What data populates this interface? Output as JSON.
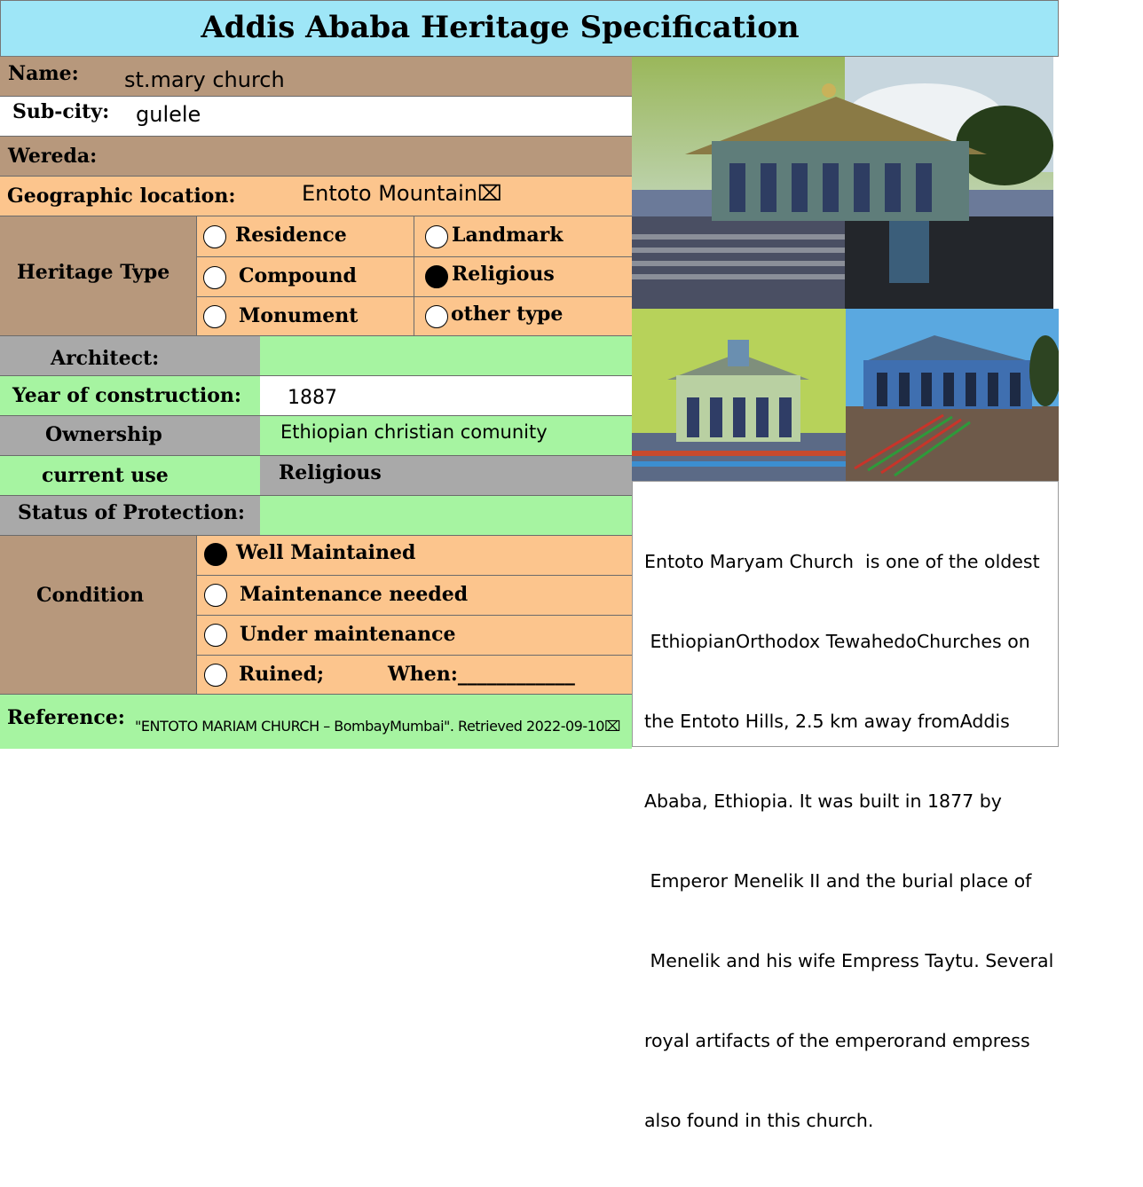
{
  "title": "Addis Ababa Heritage Specification",
  "colors": {
    "header_bg": "#9ee6f7",
    "tan": "#b7987c",
    "peach": "#fcc58d",
    "grey": "#a9a9a9",
    "green": "#a6f4a1",
    "white": "#ffffff"
  },
  "fields": {
    "name_label": "Name:",
    "name_value": "st.mary church",
    "subcity_label": "Sub-city:",
    "subcity_value": "gulele",
    "wereda_label": "Wereda:",
    "geo_label": "Geographic location:",
    "geo_value": "Entoto Mountain⌧"
  },
  "heritage_type": {
    "label": "Heritage Type",
    "options": [
      {
        "label": "Residence",
        "selected": false
      },
      {
        "label": "Landmark",
        "selected": false
      },
      {
        "label": "Compound",
        "selected": false
      },
      {
        "label": "Religious",
        "selected": true
      },
      {
        "label": "Monument",
        "selected": false
      },
      {
        "label": "other type",
        "selected": false
      }
    ]
  },
  "details": {
    "architect_label": "Architect:",
    "architect_value": "",
    "year_label": "Year of construction:",
    "year_value": "1887",
    "ownership_label": "Ownership",
    "ownership_value": "Ethiopian christian comunity",
    "use_label": "current use",
    "use_value": "Religious",
    "protection_label": "Status of Protection:",
    "protection_value": ""
  },
  "condition": {
    "label": "Condition",
    "options": [
      {
        "label": "Well Maintained",
        "selected": true
      },
      {
        "label": "Maintenance needed",
        "selected": false
      },
      {
        "label": "Under maintenance",
        "selected": false
      },
      {
        "label": "Ruined;",
        "selected": false
      }
    ],
    "when_label": "When:____________"
  },
  "reference": {
    "label": "Reference:",
    "value": "\"ENTOTO MARIAM CHURCH – BombayMumbai\". Retrieved 2022-09-10⌧"
  },
  "description": {
    "lines": [
      "Entoto Maryam Church  is one of the oldest",
      " EthiopianOrthodox TewahedoChurches on",
      "the Entoto Hills, 2.5 km away fromAddis",
      "Ababa, Ethiopia. It was built in 1877 by",
      " Emperor Menelik II and the burial place of",
      " Menelik and his wife Empress Taytu. Several",
      "royal artifacts of the emperorand empress",
      "also found in this church."
    ]
  },
  "photos": {
    "top": "church-photo",
    "bottom_left": "church-photo",
    "bottom_right": "church-photo"
  }
}
